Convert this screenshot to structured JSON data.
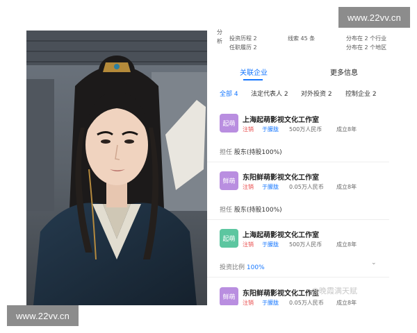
{
  "watermarks": {
    "top": "www.22vv.cn",
    "bottom": "www.22vv.cn"
  },
  "stats": {
    "side_label": "分析",
    "investment_history": "投资历程 2",
    "clues": "线索 45 条",
    "industries": "分布在 2 个行业",
    "positions_held": "任职履历 2",
    "regions": "分布在 2 个地区"
  },
  "tabs": {
    "related_companies": "关联企业",
    "more_info": "更多信息"
  },
  "filters": [
    {
      "label": "全部 4",
      "active": true
    },
    {
      "label": "法定代表人 2",
      "active": false
    },
    {
      "label": "对外投资 2",
      "active": false
    },
    {
      "label": "控制企业 2",
      "active": false
    }
  ],
  "companies": [
    {
      "logo": "起萌",
      "logo_color": "#b98ee0",
      "name": "上海起萌影视文化工作室",
      "status": "注销",
      "person": "于朦胧",
      "capital": "500万人民币",
      "founded": "成立8年"
    },
    {
      "logo": "鲜萌",
      "logo_color": "#b98ee0",
      "name": "东阳鲜萌影视文化工作室",
      "status": "注销",
      "person": "于朦胧",
      "capital": "0.05万人民币",
      "founded": "成立8年"
    },
    {
      "logo": "起萌",
      "logo_color": "#5cc6a0",
      "name": "上海起萌影视文化工作室",
      "status": "注销",
      "person": "于朦胧",
      "capital": "500万人民币",
      "founded": "成立8年"
    },
    {
      "logo": "鲜萌",
      "logo_color": "#b98ee0",
      "name": "东阳鲜萌影视文化工作室",
      "status": "注销",
      "person": "于朦胧",
      "capital": "0.05万人民币",
      "founded": "成立8年"
    }
  ],
  "roles": [
    {
      "label": "担任",
      "value": "股东(持股100%)"
    },
    {
      "label": "担任",
      "value": "股东(持股100%)"
    }
  ],
  "investment_ratio": {
    "label": "投资比例",
    "value": "100%"
  },
  "weibo_watermark": "@晚霞满天赋",
  "colors": {
    "accent": "#1677ff",
    "status_red": "#e84b4b",
    "person_blue": "#1677ff"
  }
}
